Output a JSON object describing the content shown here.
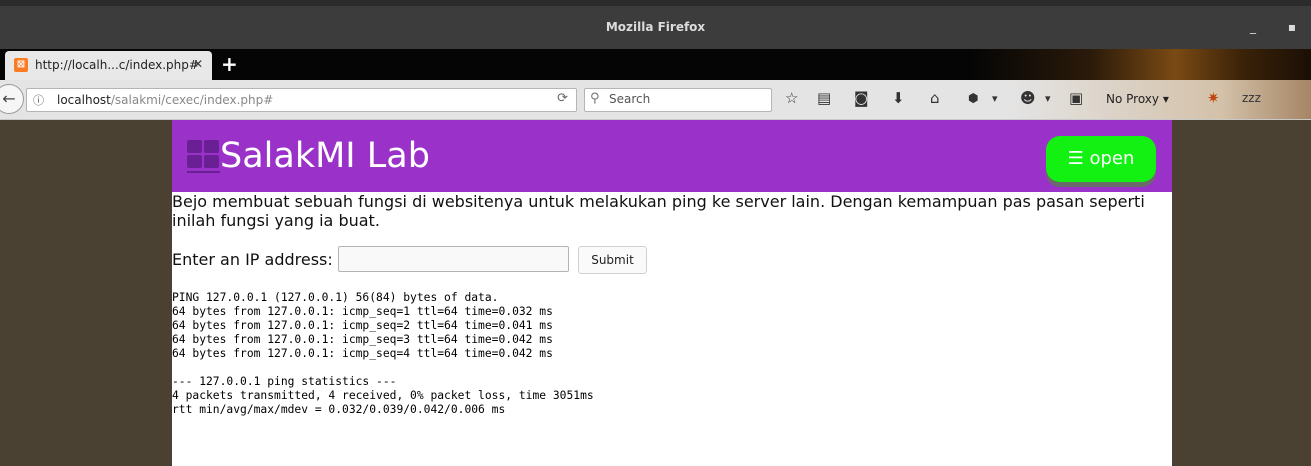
{
  "window": {
    "title": "Mozilla Firefox",
    "minimize": "_",
    "close": "▪"
  },
  "tab": {
    "favicon": "xampp-icon",
    "label": "http://localh...c/index.php#",
    "close": "✕"
  },
  "new_tab": "+",
  "urlbar": {
    "host": "localhost",
    "path": "/salakmi/cexec/index.php#"
  },
  "search": {
    "placeholder": "Search"
  },
  "toolbar": {
    "proxy_label": "No Proxy"
  },
  "site": {
    "title": "SalakMI Lab",
    "menu_button": "☰ open"
  },
  "content": {
    "description": "Bejo membuat sebuah fungsi di websitenya untuk melakukan ping ke server lain. Dengan kemampuan pas pasan seperti inilah fungsi yang ia buat.",
    "ip_label": "Enter an IP address:",
    "submit_label": "Submit",
    "output_lines": [
      "PING 127.0.0.1 (127.0.0.1) 56(84) bytes of data.",
      "64 bytes from 127.0.0.1: icmp_seq=1 ttl=64 time=0.032 ms",
      "64 bytes from 127.0.0.1: icmp_seq=2 ttl=64 time=0.041 ms",
      "64 bytes from 127.0.0.1: icmp_seq=3 ttl=64 time=0.042 ms",
      "64 bytes from 127.0.0.1: icmp_seq=4 ttl=64 time=0.042 ms",
      "",
      "--- 127.0.0.1 ping statistics ---",
      "4 packets transmitted, 4 received, 0% packet loss, time 3051ms",
      "rtt min/avg/max/mdev = 0.032/0.039/0.042/0.006 ms"
    ]
  },
  "colors": {
    "header": "#9a31c9",
    "open_button": "#13f113",
    "background": "#4a4133"
  }
}
